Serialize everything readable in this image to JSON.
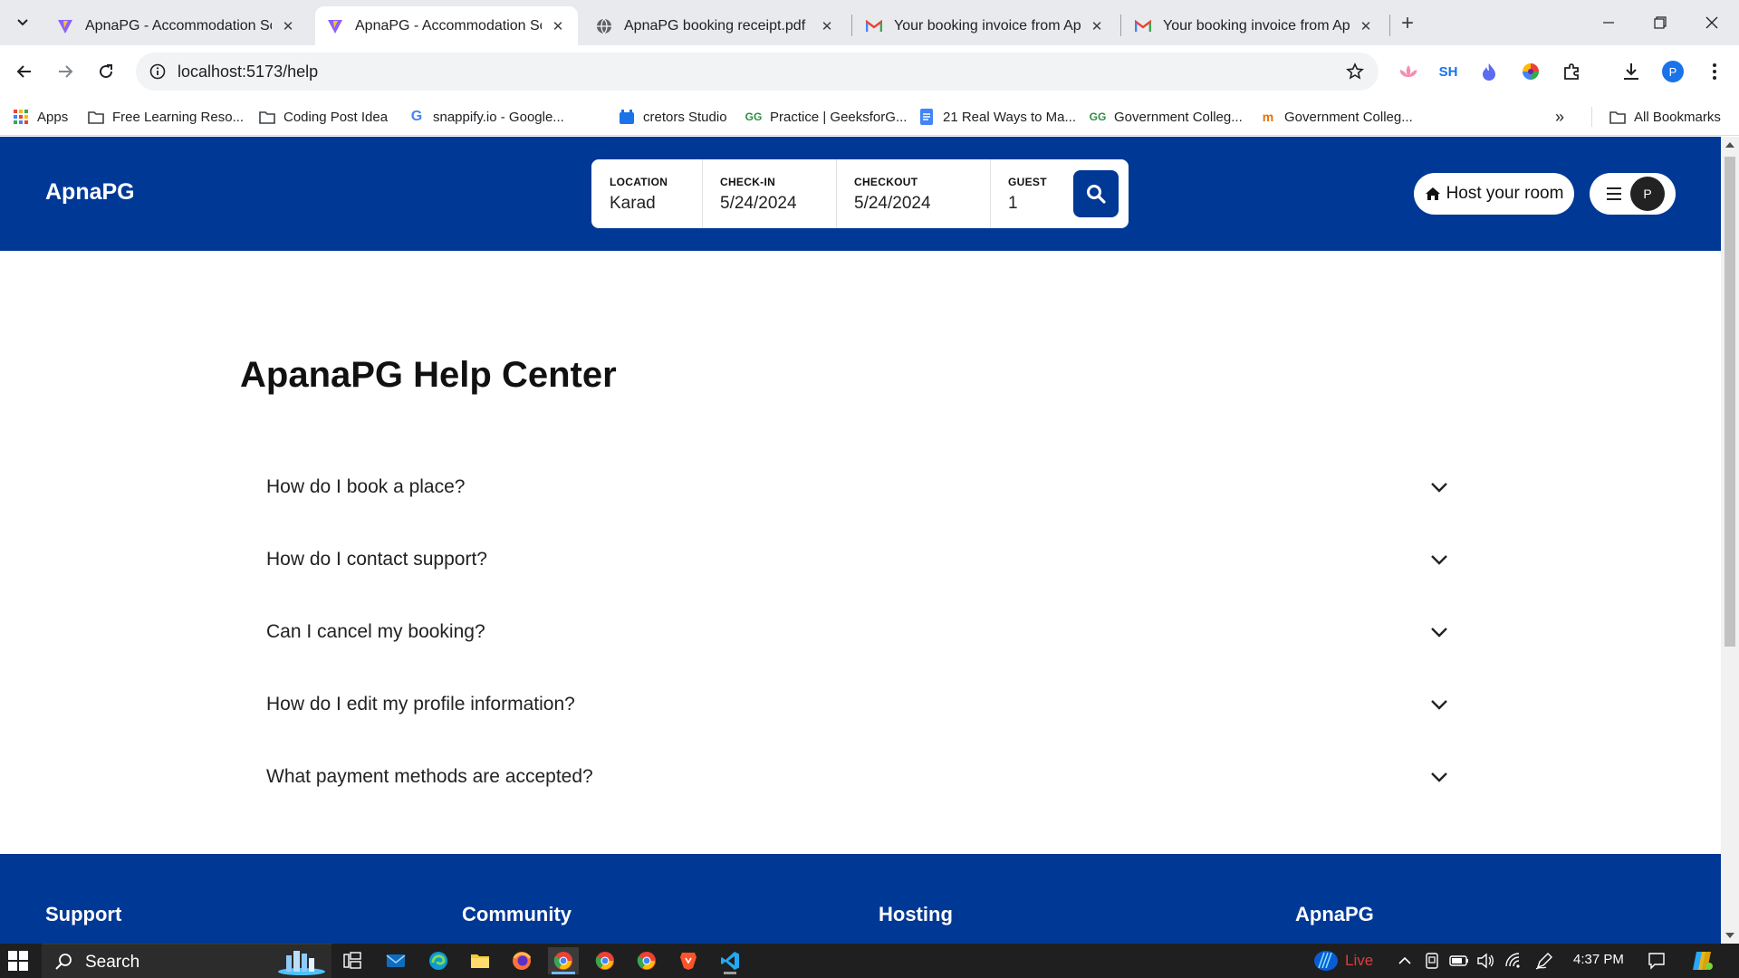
{
  "browser": {
    "tabs": [
      {
        "title": "ApnaPG - Accommodation Solu",
        "icon": "vite-icon",
        "active": false
      },
      {
        "title": "ApnaPG - Accommodation Solu",
        "icon": "vite-icon",
        "active": true
      },
      {
        "title": "ApnaPG booking receipt.pdf",
        "icon": "globe-icon",
        "active": false
      },
      {
        "title": "Your booking invoice from Apn",
        "icon": "gmail-icon",
        "active": false
      },
      {
        "title": "Your booking invoice from Apn",
        "icon": "gmail-icon",
        "active": false
      }
    ],
    "url": "localhost:5173/help",
    "profile_initial": "P",
    "extensions": [
      "SH"
    ],
    "bookmarks": [
      {
        "label": "Apps",
        "icon": "apps-grid-icon"
      },
      {
        "label": "Free Learning Reso...",
        "icon": "folder-icon"
      },
      {
        "label": "Coding Post Idea",
        "icon": "folder-icon"
      },
      {
        "label": "snappify.io - Google...",
        "icon": "google-icon"
      },
      {
        "label": "cretors Studio",
        "icon": "studio-icon"
      },
      {
        "label": "Practice | GeeksforG...",
        "icon": "geeksforgeeks-icon"
      },
      {
        "label": "21 Real Ways to Ma...",
        "icon": "docs-icon"
      },
      {
        "label": "Government Colleg...",
        "icon": "geeksforgeeks-icon"
      },
      {
        "label": "Government Colleg...",
        "icon": "college-icon"
      }
    ],
    "all_bookmarks_label": "All Bookmarks"
  },
  "header": {
    "logo": "ApnaPG",
    "search": {
      "location_label": "LOCATION",
      "location_value": "Karad",
      "checkin_label": "CHECK-IN",
      "checkin_value": "5/24/2024",
      "checkout_label": "CHECKOUT",
      "checkout_value": "5/24/2024",
      "guest_label": "GUEST",
      "guest_value": "1"
    },
    "host_button": "Host your room",
    "avatar_initial": "P"
  },
  "main": {
    "title": "ApanaPG Help Center",
    "faqs": [
      "How do I book a place?",
      "How do I contact support?",
      "Can I cancel my booking?",
      "How do I edit my profile information?",
      "What payment methods are accepted?"
    ]
  },
  "footer": {
    "headings": [
      "Support",
      "Community",
      "Hosting",
      "ApnaPG"
    ]
  },
  "taskbar": {
    "search_label": "Search",
    "live_label": "Live",
    "time": "4:37 PM"
  },
  "colors": {
    "brand_blue": "#003896",
    "tab_strip": "#e8eaed",
    "taskbar": "#1f1f1f"
  }
}
